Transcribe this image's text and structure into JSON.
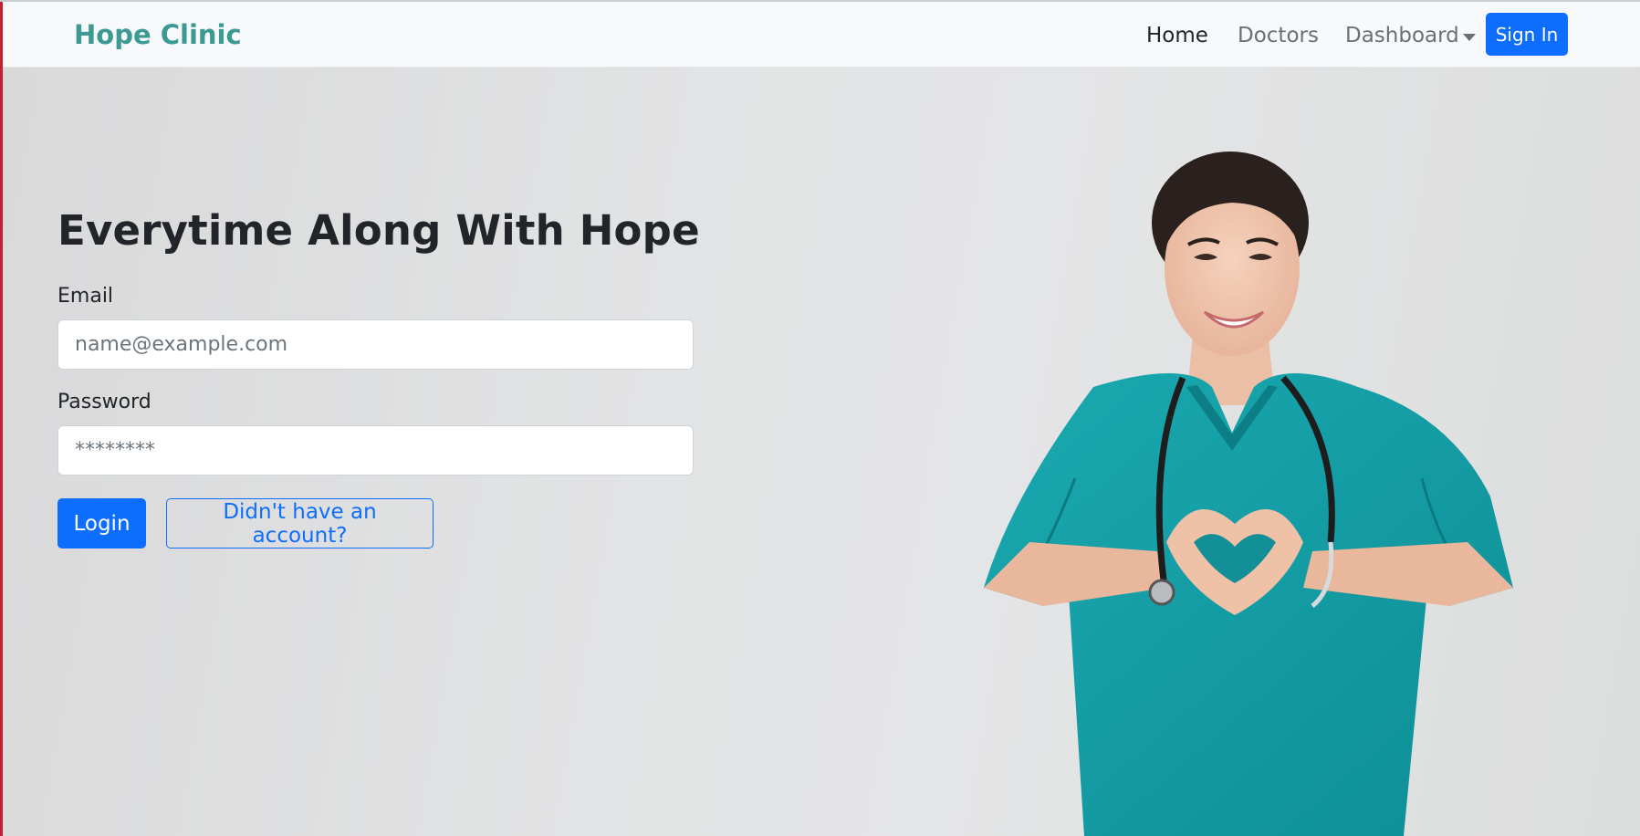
{
  "navbar": {
    "brand": "Hope Clinic",
    "links": [
      {
        "label": "Home",
        "active": true
      },
      {
        "label": "Doctors",
        "active": false
      },
      {
        "label": "Dashboard",
        "active": false,
        "dropdown": true
      }
    ],
    "signin_label": "Sign In"
  },
  "hero": {
    "headline": "Everytime Along With Hope",
    "photo_icon": "doctor-heart-hands-photo"
  },
  "login_form": {
    "email_label": "Email",
    "email_placeholder": "name@example.com",
    "email_value": "",
    "password_label": "Password",
    "password_placeholder": "********",
    "password_value": "",
    "login_label": "Login",
    "register_label": "Didn't have an account?"
  },
  "colors": {
    "brand": "#3c9a93",
    "primary": "#0d6efd",
    "scrubs": "#14a0a8",
    "background": "#dcdcdd"
  }
}
